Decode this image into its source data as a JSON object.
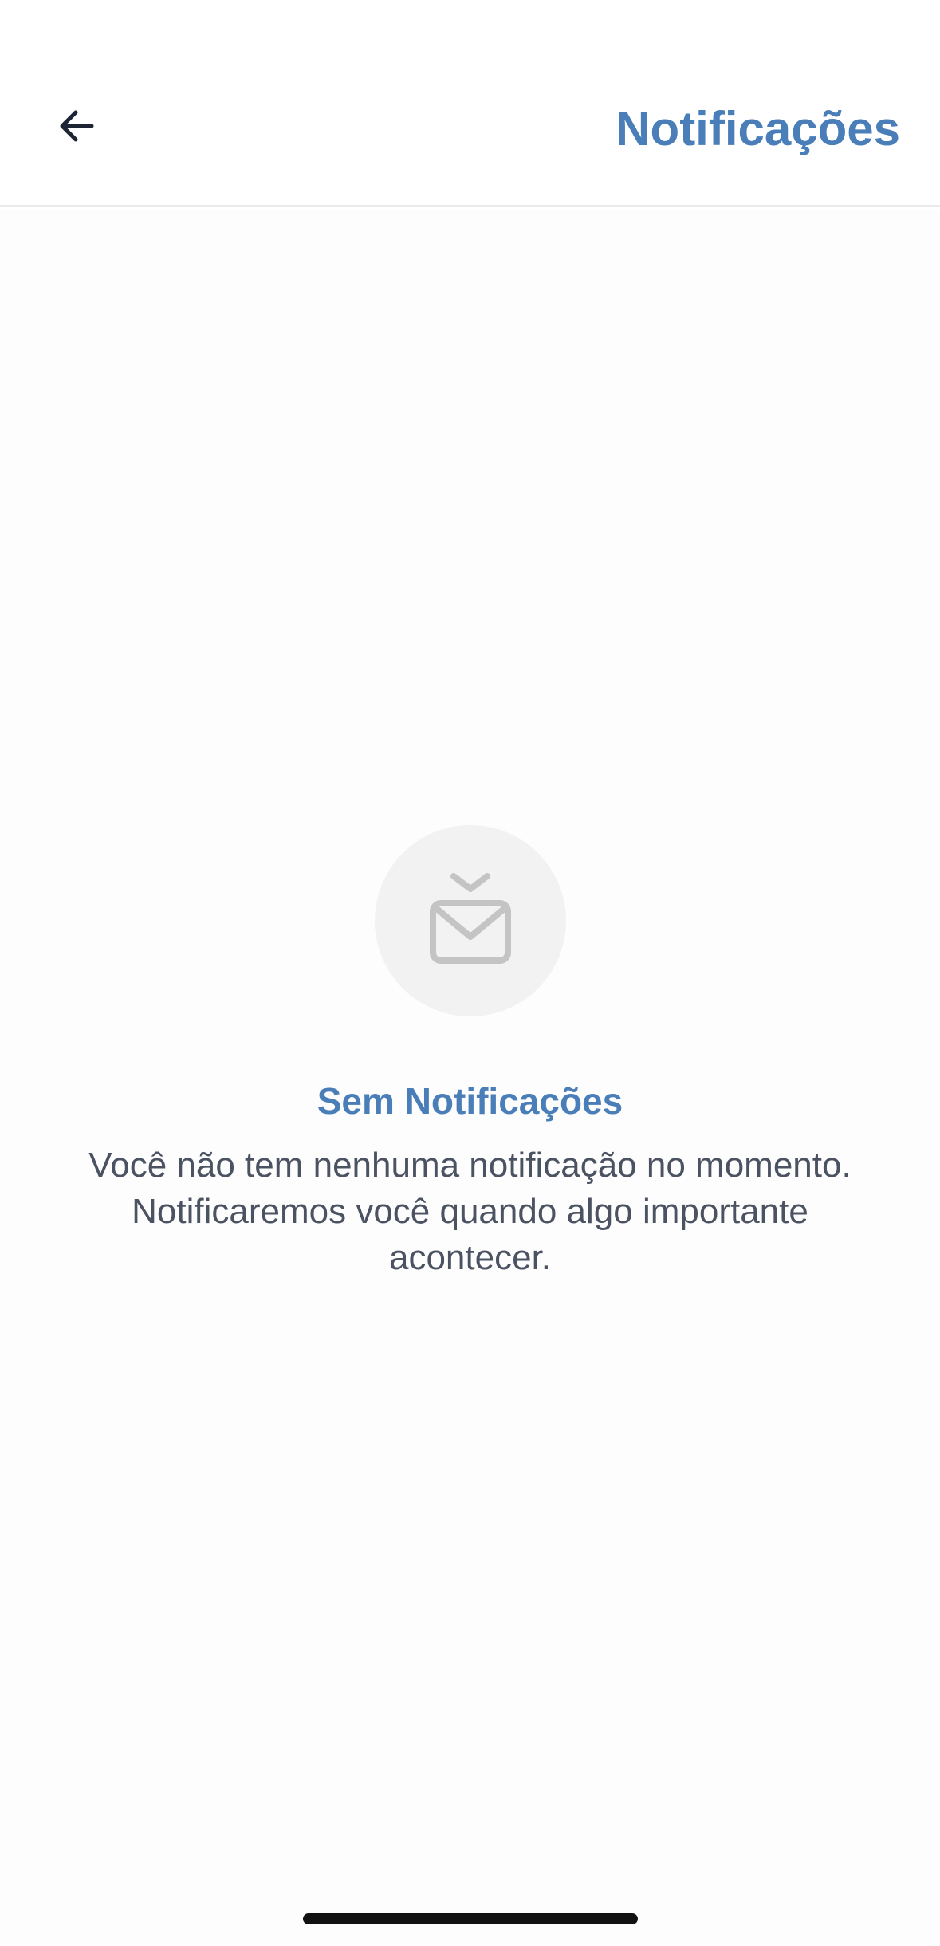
{
  "header": {
    "title": "Notificações",
    "back_icon": "arrow-left-icon"
  },
  "empty_state": {
    "icon": "mail-inbox-download-icon",
    "title": "Sem Notificações",
    "message": "Você não tem nenhuma notificação no momento. Notificaremos você quando algo importante acontecer."
  },
  "colors": {
    "accent": "#4a7eb8",
    "text_secondary": "#4b5262",
    "icon_gray": "#c4c4c4",
    "circle_bg": "#f2f2f2"
  }
}
